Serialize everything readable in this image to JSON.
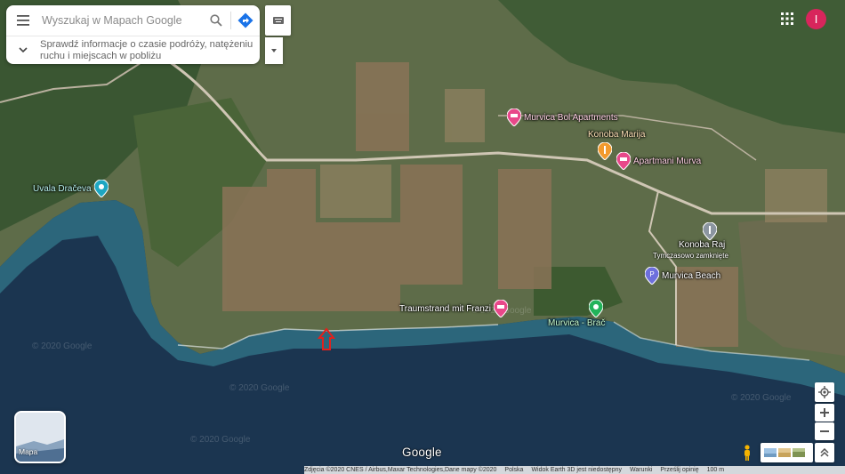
{
  "search": {
    "placeholder": "Wyszukaj w Mapach Google",
    "info_text": "Sprawdź informacje o czasie podróży, natężeniu ruchu i miejscach w pobliżu"
  },
  "account": {
    "initial": "I",
    "color": "#d8255c"
  },
  "pois": [
    {
      "name": "Murvica Bol Apartments",
      "icon": "hotel-pin-icon",
      "color": "#e8488a"
    },
    {
      "name": "Konoba Marija",
      "icon": "restaurant-pin-icon",
      "color": "#f29a2e"
    },
    {
      "name": "Apartmani Murva",
      "icon": "hotel-pin-icon",
      "color": "#e8488a"
    },
    {
      "name": "Uvala Dračeva",
      "icon": "beach-pin-icon",
      "color": "#1ea7c2"
    },
    {
      "name": "Konoba Raj",
      "sub": "Tymczasowo zamknięte",
      "icon": "restaurant-pin-icon",
      "color": "#8b95a0"
    },
    {
      "name": "Murvica Beach",
      "icon": "parking-pin-icon",
      "color": "#6d6fdc"
    },
    {
      "name": "Traumstrand mit Franzi",
      "icon": "hotel-pin-icon",
      "color": "#e8488a"
    },
    {
      "name": "Murvica - Brač",
      "icon": "place-pin-icon",
      "color": "#22b35a"
    }
  ],
  "watermarks": [
    "© 2020 Google",
    "© 2020 Google",
    "© 2020 Google",
    "© 2020 Google",
    "© 2020 Google"
  ],
  "layer_switcher": {
    "label": "Mapa"
  },
  "logo": "Google",
  "footer": [
    "Zdjęcia ©2020 CNES / Airbus,Maxar Technologies,Dane mapy ©2020",
    "Polska",
    "Widok Earth 3D jest niedostępny",
    "Warunki",
    "Prześlij opinię",
    "100 m"
  ],
  "colors": {
    "sea_deep": "#1b3550",
    "sea_shallow": "#2d6f86",
    "land": "#6f7c5a",
    "vegetation": "#3c5a33",
    "marker_red": "#e3201b"
  }
}
